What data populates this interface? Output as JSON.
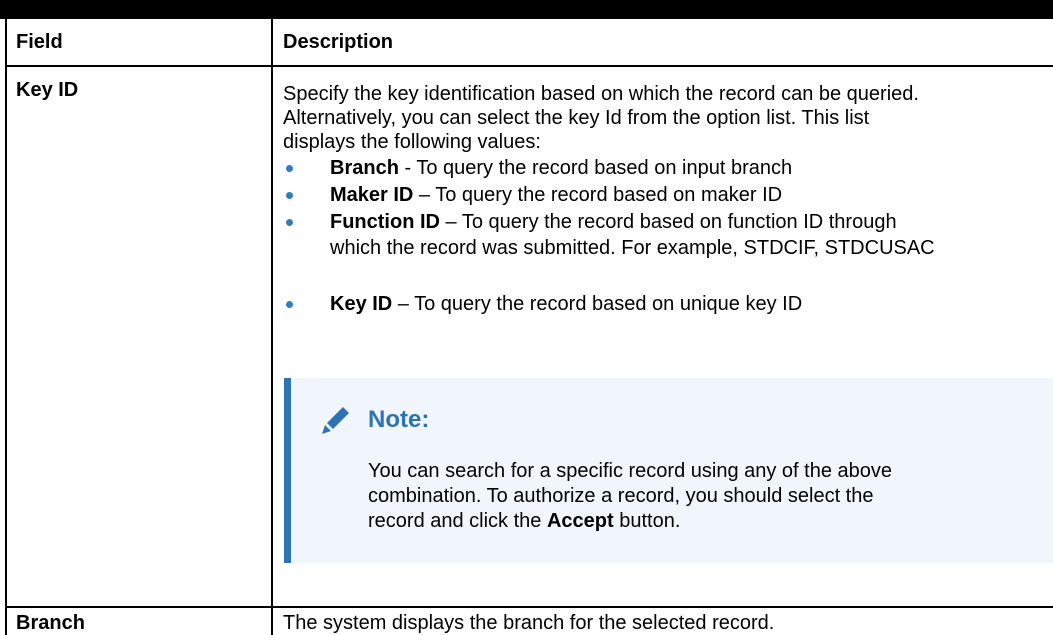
{
  "table": {
    "headers": {
      "field": "Field",
      "description": "Description"
    },
    "rows": [
      {
        "field": "Key ID",
        "description_lines": [
          "Specify the key identification based on which the record can be queried.",
          "Alternatively, you can select the key Id from the option list. This list",
          "displays the following values:"
        ],
        "bullets": [
          {
            "term": "Branch",
            "text": " - To query the record based on input branch"
          },
          {
            "term": "Maker ID",
            "text": " – To query the record based on maker ID"
          },
          {
            "term": "Function ID",
            "text": " – To query the record based on function ID through",
            "text2": "which the record was submitted. For example, STDCIF, STDCUSAC"
          },
          {
            "term": "Key ID",
            "text": " – To query the record based on unique key ID"
          }
        ],
        "note": {
          "title": "Note:",
          "line1": "You can search for a specific record using any of the above",
          "line2": "combination. To authorize a record, you should select the",
          "line3_pre": "record and click the ",
          "line3_bold": "Accept",
          "line3_post": " button."
        }
      },
      {
        "field": "Branch",
        "description": "The system displays the branch for the selected record."
      }
    ]
  },
  "colors": {
    "note_accent": "#2e74b5",
    "note_bg": "#f1f6fc",
    "bullet": "#2e7dc1"
  },
  "icons": {
    "note_icon": "pencil-icon"
  }
}
